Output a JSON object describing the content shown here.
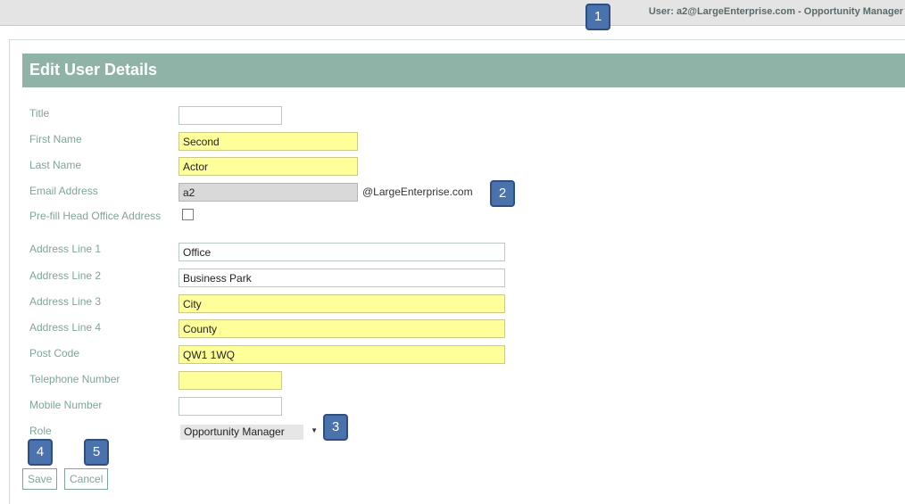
{
  "header": {
    "user_info": "User: a2@LargeEnterprise.com - Opportunity Manager"
  },
  "page": {
    "title": "Edit User Details"
  },
  "form": {
    "title": {
      "label": "Title",
      "value": ""
    },
    "first_name": {
      "label": "First Name",
      "value": "Second"
    },
    "last_name": {
      "label": "Last Name",
      "value": "Actor"
    },
    "email": {
      "label": "Email Address",
      "value": "a2",
      "domain": "@LargeEnterprise.com"
    },
    "prefill": {
      "label": "Pre-fill Head Office Address",
      "checked": false
    },
    "address1": {
      "label": "Address Line 1",
      "value": "Office"
    },
    "address2": {
      "label": "Address Line 2",
      "value": "Business Park"
    },
    "address3": {
      "label": "Address Line 3",
      "value": "City"
    },
    "address4": {
      "label": "Address Line 4",
      "value": "County"
    },
    "postcode": {
      "label": "Post Code",
      "value": "QW1 1WQ"
    },
    "telephone": {
      "label": "Telephone Number",
      "value": ""
    },
    "mobile": {
      "label": "Mobile Number",
      "value": ""
    },
    "role": {
      "label": "Role",
      "value": "Opportunity Manager"
    }
  },
  "buttons": {
    "save": "Save",
    "cancel": "Cancel"
  },
  "callouts": [
    "1",
    "2",
    "3",
    "4",
    "5"
  ],
  "colors": {
    "header_bg": "#8fb3a6",
    "label": "#7fa49a",
    "required_bg": "#ffff99",
    "readonly_bg": "#d9d9d9",
    "callout_bg": "#4a72ac"
  }
}
